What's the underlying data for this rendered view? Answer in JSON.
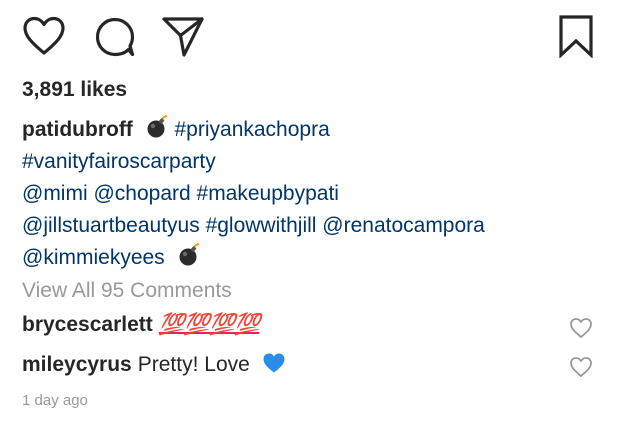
{
  "post": {
    "likes_text": "3,891 likes",
    "caption": {
      "username": "patidubroff",
      "line1_tag": "#priyankachopra",
      "line2": "#vanityfairoscarparty",
      "line3": "@mimi @chopard #makeupbypati",
      "line4": "@jillstuartbeautyus #glowwithjill @renatocampora",
      "line5": "@kimmiekyees"
    },
    "view_all_comments": "View All 95 Comments",
    "comments": [
      {
        "username": "brycescarlett",
        "text": "💯💯💯💯"
      },
      {
        "username": "mileycyrus",
        "text": "Pretty! Love"
      }
    ],
    "timestamp": "1 day ago"
  },
  "icons": {
    "like": "heart-outline-icon",
    "comment": "comment-bubble-icon",
    "share": "paper-plane-icon",
    "save": "bookmark-icon",
    "bomb": "bomb-emoji-icon",
    "blue_heart": "blue-heart-emoji-icon",
    "comment_like": "heart-outline-small-icon"
  },
  "colors": {
    "text": "#262626",
    "link": "#003569",
    "muted": "#999999",
    "hundred_red": "#e0245e",
    "blue_heart": "#2a8ee8"
  }
}
